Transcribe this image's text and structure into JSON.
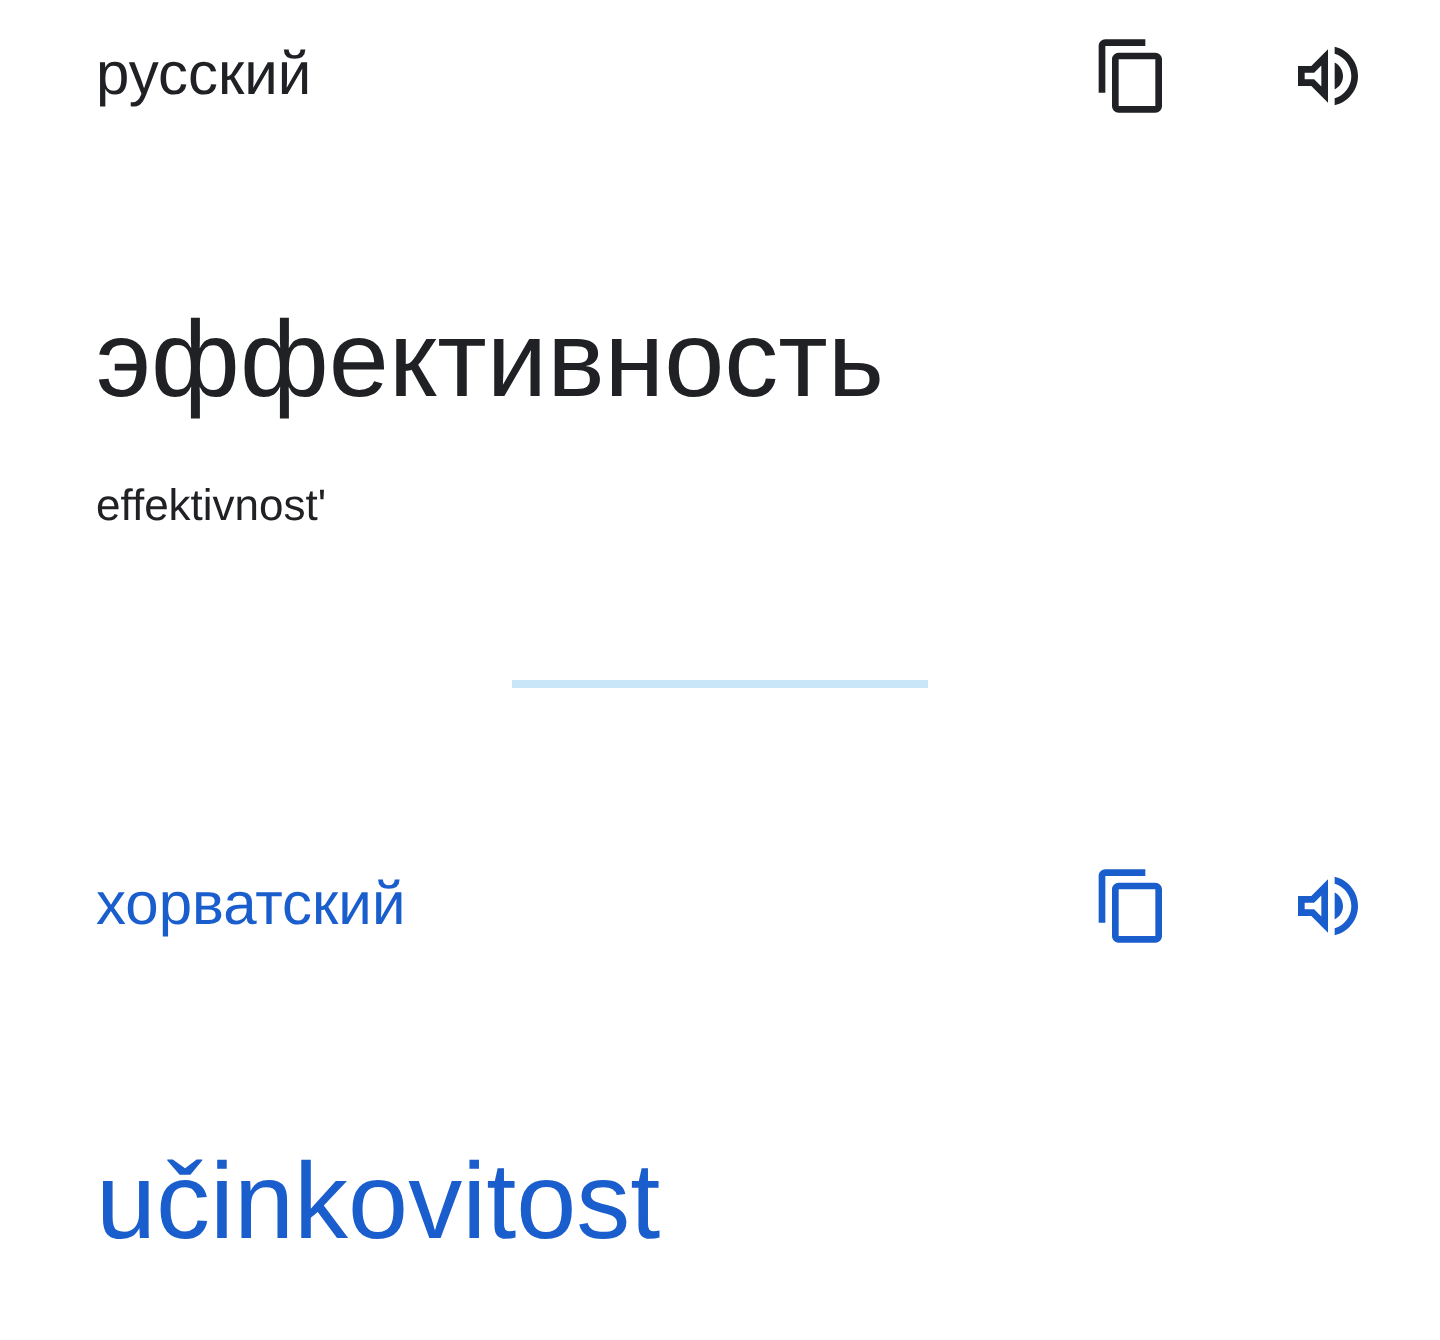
{
  "source": {
    "language": "русский",
    "word": "эффективность",
    "transliteration": "effektivnost'"
  },
  "target": {
    "language": "хорватский",
    "word": "učinkovitost"
  }
}
